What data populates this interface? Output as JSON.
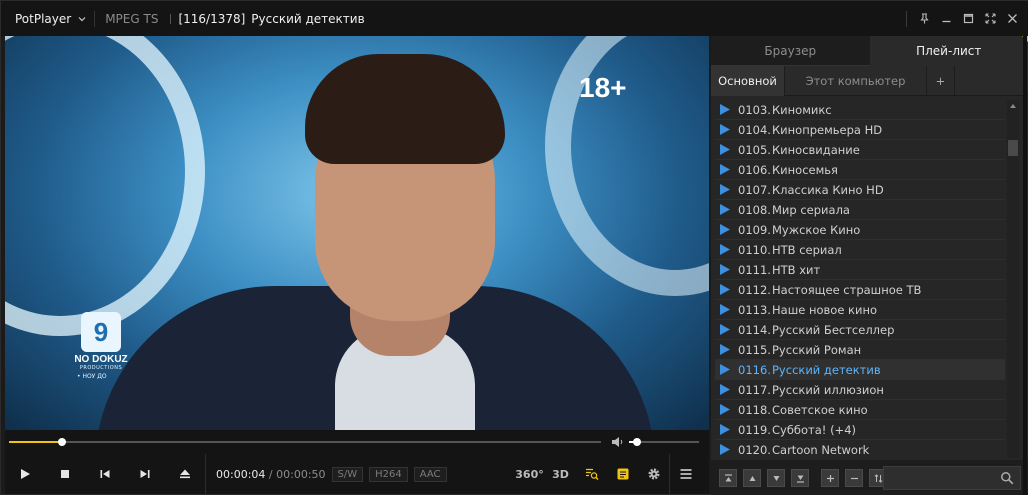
{
  "app": {
    "name": "PotPlayer"
  },
  "titlebar": {
    "format": "MPEG TS",
    "counter": "[116/1378]",
    "title": "Русский детектив"
  },
  "video": {
    "age_rating": "18+",
    "logo_mark": "9",
    "logo_name": "NO DOKUZ",
    "logo_sub": "PRODUCTIONS",
    "logo_caption": "• НОУ ДО"
  },
  "playback": {
    "progress": 0.09,
    "volume": 0.12,
    "current_time": "00:00:04",
    "time_separator": "/",
    "total_time": "00:00:50",
    "badges": [
      "S/W",
      "H264",
      "AAC"
    ]
  },
  "right_tools": {
    "vr": "360°",
    "threed": "3D"
  },
  "panel": {
    "tabs": [
      "Браузер",
      "Плей-лист"
    ],
    "active_tab": 1,
    "subtabs": [
      "Основной",
      "Этот компьютер",
      "+"
    ],
    "items": [
      {
        "num": "0103.",
        "title": "Киномикс"
      },
      {
        "num": "0104.",
        "title": "Кинопремьера HD"
      },
      {
        "num": "0105.",
        "title": "Киносвидание"
      },
      {
        "num": "0106.",
        "title": "Киносемья"
      },
      {
        "num": "0107.",
        "title": "Классика Кино HD"
      },
      {
        "num": "0108.",
        "title": "Мир сериала"
      },
      {
        "num": "0109.",
        "title": "Мужское Кино"
      },
      {
        "num": "0110.",
        "title": "НТВ сериал"
      },
      {
        "num": "0111.",
        "title": "НТВ хит"
      },
      {
        "num": "0112.",
        "title": "Настоящее страшное ТВ"
      },
      {
        "num": "0113.",
        "title": "Наше новое кино"
      },
      {
        "num": "0114.",
        "title": "Русский Бестселлер"
      },
      {
        "num": "0115.",
        "title": "Русский Роман"
      },
      {
        "num": "0116.",
        "title": "Русский детектив"
      },
      {
        "num": "0117.",
        "title": "Русский иллюзион"
      },
      {
        "num": "0118.",
        "title": "Советское кино"
      },
      {
        "num": "0119.",
        "title": "Суббота! (+4)"
      },
      {
        "num": "0120.",
        "title": "Cartoon Network"
      }
    ],
    "active_index": 13,
    "search_value": ""
  },
  "colors": {
    "accent": "#f2c40f",
    "active_text": "#5db6ff",
    "play_icon": "#3d8fe0"
  }
}
